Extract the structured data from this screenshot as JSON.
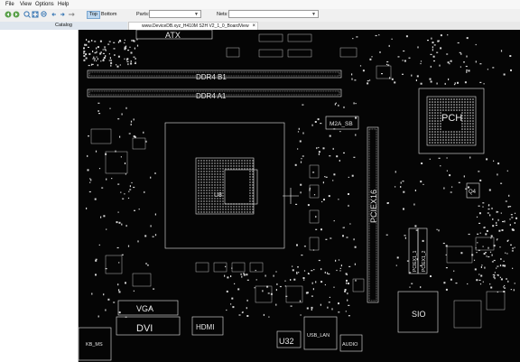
{
  "menu": [
    "File",
    "View",
    "Options",
    "Help"
  ],
  "toolbar": {
    "icons": [
      "nav-back-icon",
      "nav-forward-icon",
      "zoom-in-icon",
      "fit-icon",
      "zoom-out-icon",
      "arrow-left-icon",
      "arrow-right-icon"
    ],
    "top_label": "Top",
    "bottom_label": "Bottom",
    "active_side": "Top",
    "parts_label": "Parts:",
    "nets_label": "Nets:"
  },
  "tabs": {
    "catalog": "Catalog",
    "file": "www.DeviceDB.xyz_H410M S2H V2_1_0_BoardView"
  },
  "board": {
    "labels": {
      "atx": "ATX",
      "ddr4_b1": "DDR4  B1",
      "ddr4_a1": "DDR4  A1",
      "m2a": "M2A_SB",
      "pch": "PCH",
      "pciex16": "PCIEX16",
      "pciex1": "PCIEX1_1",
      "pciex1b": "PCIEX1_2",
      "sio": "SIO",
      "vga": "VGA",
      "dvi": "DVI",
      "hdmi": "HDMI",
      "u32": "U32",
      "usb_lan": "USB_LAN",
      "audio": "AUDIO",
      "kb_ms": "KB_MS",
      "q4": "Q4",
      "cpu": "U8"
    },
    "colors": {
      "trace": "#e8e8e8",
      "background": "#050505"
    }
  }
}
